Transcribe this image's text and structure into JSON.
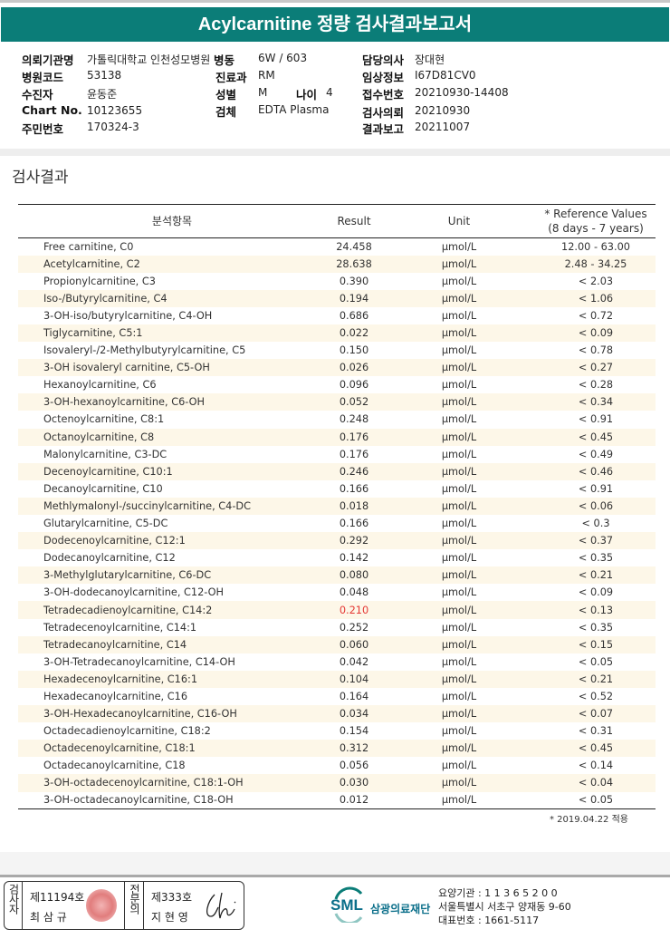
{
  "title": "Acylcarnitine 정량 검사결과보고서",
  "info": {
    "institution_label": "의뢰기관명",
    "institution": "가톨릭대학교 인천성모병원",
    "ward_label": "병동",
    "ward": "6W / 603",
    "doctor_label": "담당의사",
    "doctor": "장대현",
    "hospital_code_label": "병원코드",
    "hospital_code": "53138",
    "dept_label": "진료과",
    "dept": "RM",
    "clinical_label": "임상정보",
    "clinical": "I67D81CV0",
    "patient_label": "수진자",
    "patient": "윤동준",
    "sex_label": "성별",
    "sex": "M",
    "age_label": "나이",
    "age": "4",
    "receipt_label": "접수번호",
    "receipt": "20210930-14408",
    "chart_label": "Chart No.",
    "chart": "10123655",
    "specimen_label": "검체",
    "specimen": "EDTA Plasma",
    "request_label": "검사의뢰",
    "request": "20210930",
    "id_label": "주민번호",
    "id": "170324-3",
    "report_label": "결과보고",
    "report": "20211007"
  },
  "section_title": "검사결과",
  "table": {
    "headers": {
      "item": "분석항목",
      "result": "Result",
      "unit": "Unit",
      "ref1": "* Reference Values",
      "ref2": "(8 days - 7 years)"
    },
    "rows": [
      [
        "Free carnitine, C0",
        "24.458",
        "µmol/L",
        "12.00 - 63.00"
      ],
      [
        "Acetylcarnitine, C2",
        "28.638",
        "µmol/L",
        "2.48 - 34.25"
      ],
      [
        "Propionylcarnitine, C3",
        "0.390",
        "µmol/L",
        "< 2.03"
      ],
      [
        "Iso-/Butyrylcarnitine, C4",
        "0.194",
        "µmol/L",
        "< 1.06"
      ],
      [
        "3-OH-iso/butyrylcarnitine, C4-OH",
        "0.686",
        "µmol/L",
        "< 0.72"
      ],
      [
        "Tiglycarnitine, C5:1",
        "0.022",
        "µmol/L",
        "< 0.09"
      ],
      [
        "Isovaleryl-/2-Methylbutyrylcarnitine, C5",
        "0.150",
        "µmol/L",
        "< 0.78"
      ],
      [
        "3-OH isovaleryl carnitine, C5-OH",
        "0.026",
        "µmol/L",
        "< 0.27"
      ],
      [
        "Hexanoylcarnitine, C6",
        "0.096",
        "µmol/L",
        "< 0.28"
      ],
      [
        "3-OH-hexanoylcarnitine, C6-OH",
        "0.052",
        "µmol/L",
        "< 0.34"
      ],
      [
        "Octenoylcarnitine, C8:1",
        "0.248",
        "µmol/L",
        "< 0.91"
      ],
      [
        "Octanoylcarnitine, C8",
        "0.176",
        "µmol/L",
        "< 0.45"
      ],
      [
        "Malonylcarnitine, C3-DC",
        "0.176",
        "µmol/L",
        "< 0.49"
      ],
      [
        "Decenoylcarnitine, C10:1",
        "0.246",
        "µmol/L",
        "< 0.46"
      ],
      [
        "Decanoylcarnitine, C10",
        "0.166",
        "µmol/L",
        "< 0.91"
      ],
      [
        "Methlymalonyl-/succinylcarnitine, C4-DC",
        "0.018",
        "µmol/L",
        "< 0.06"
      ],
      [
        "Glutarylcarnitine, C5-DC",
        "0.166",
        "µmol/L",
        "< 0.3"
      ],
      [
        "Dodecenoylcarnitine, C12:1",
        "0.292",
        "µmol/L",
        "< 0.37"
      ],
      [
        "Dodecanoylcarnitine, C12",
        "0.142",
        "µmol/L",
        "< 0.35"
      ],
      [
        "3-Methylglutarylcarnitine, C6-DC",
        "0.080",
        "µmol/L",
        "< 0.21"
      ],
      [
        "3-OH-dodecanoylcarnitine, C12-OH",
        "0.048",
        "µmol/L",
        "< 0.09"
      ],
      [
        "Tetradecadienoylcarnitine, C14:2",
        "0.210",
        "µmol/L",
        "< 0.13"
      ],
      [
        "Tetradecenoylcarnitine, C14:1",
        "0.252",
        "µmol/L",
        "< 0.35"
      ],
      [
        "Tetradecanoylcarnitine, C14",
        "0.060",
        "µmol/L",
        "< 0.15"
      ],
      [
        "3-OH-Tetradecanoylcarnitine, C14-OH",
        "0.042",
        "µmol/L",
        "< 0.05"
      ],
      [
        "Hexadecenoylcarnitine, C16:1",
        "0.104",
        "µmol/L",
        "< 0.21"
      ],
      [
        "Hexadecanoylcarnitine, C16",
        "0.164",
        "µmol/L",
        "< 0.52"
      ],
      [
        "3-OH-Hexadecanoylcarnitine, C16-OH",
        "0.034",
        "µmol/L",
        "< 0.07"
      ],
      [
        "Octadecadienoylcarnitine, C18:2",
        "0.154",
        "µmol/L",
        "< 0.31"
      ],
      [
        "Octadecenoylcarnitine, C18:1",
        "0.312",
        "µmol/L",
        "< 0.45"
      ],
      [
        "Octadecanoylcarnitine, C18",
        "0.056",
        "µmol/L",
        "< 0.14"
      ],
      [
        "3-OH-octadecenoylcarnitine, C18:1-OH",
        "0.030",
        "µmol/L",
        "< 0.04"
      ],
      [
        "3-OH-octadecanoylcarnitine, C18-OH",
        "0.012",
        "µmol/L",
        "< 0.05"
      ]
    ],
    "abnormal_rows": [
      21
    ],
    "abnormal_color": "#e53935"
  },
  "note": "* 2019.04.22 적용",
  "footer": {
    "examiner_label": "검사자",
    "examiner_no": "제11194호",
    "examiner_name": "최 삼 규",
    "specialist_label": "전문의",
    "specialist_no": "제333호",
    "specialist_name": "지 현 영",
    "logo_text": "SML",
    "org_name": "삼광의료재단",
    "code": "요양기관 : 1 1 3 6 5 2 0 0",
    "address": "서울특별시 서초구 양재동 9-60",
    "phone": "대표번호 : 1661-5117"
  },
  "colors": {
    "header_bg": "#0b7d78",
    "row_alt": "#fdf7e8"
  }
}
